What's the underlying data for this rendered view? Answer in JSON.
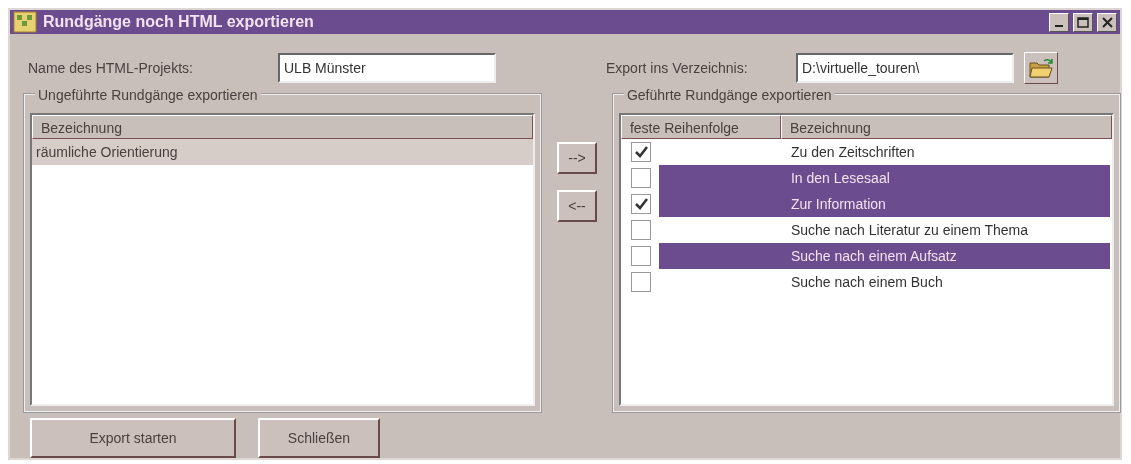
{
  "window": {
    "title": "Rundgänge noch HTML exportieren"
  },
  "project": {
    "label": "Name des HTML-Projekts:",
    "value": "ULB Münster"
  },
  "directory": {
    "label": "Export ins Verzeichnis:",
    "value": "D:\\virtuelle_touren\\"
  },
  "unguided": {
    "title": "Ungeführte Rundgänge exportieren",
    "columns": [
      "Bezeichnung"
    ],
    "rows": [
      {
        "name": "räumliche Orientierung",
        "selected": true
      }
    ]
  },
  "move_buttons": [
    "-->",
    "<--"
  ],
  "guided": {
    "title": "Geführte Rundgänge exportieren",
    "columns": [
      "feste Reihenfolge",
      "Bezeichnung"
    ],
    "rows": [
      {
        "name": "Zu den Zeitschriften",
        "checked": true,
        "selected": false
      },
      {
        "name": "In den Lesesaal",
        "checked": false,
        "selected": true
      },
      {
        "name": "Zur Information",
        "checked": true,
        "selected": true
      },
      {
        "name": "Suche nach Literatur zu einem Thema",
        "checked": false,
        "selected": false
      },
      {
        "name": "Suche nach einem Aufsatz",
        "checked": false,
        "selected": true
      },
      {
        "name": "Suche nach einem Buch",
        "checked": false,
        "selected": false
      }
    ]
  },
  "buttons": [
    "Export starten",
    "Schließen"
  ]
}
